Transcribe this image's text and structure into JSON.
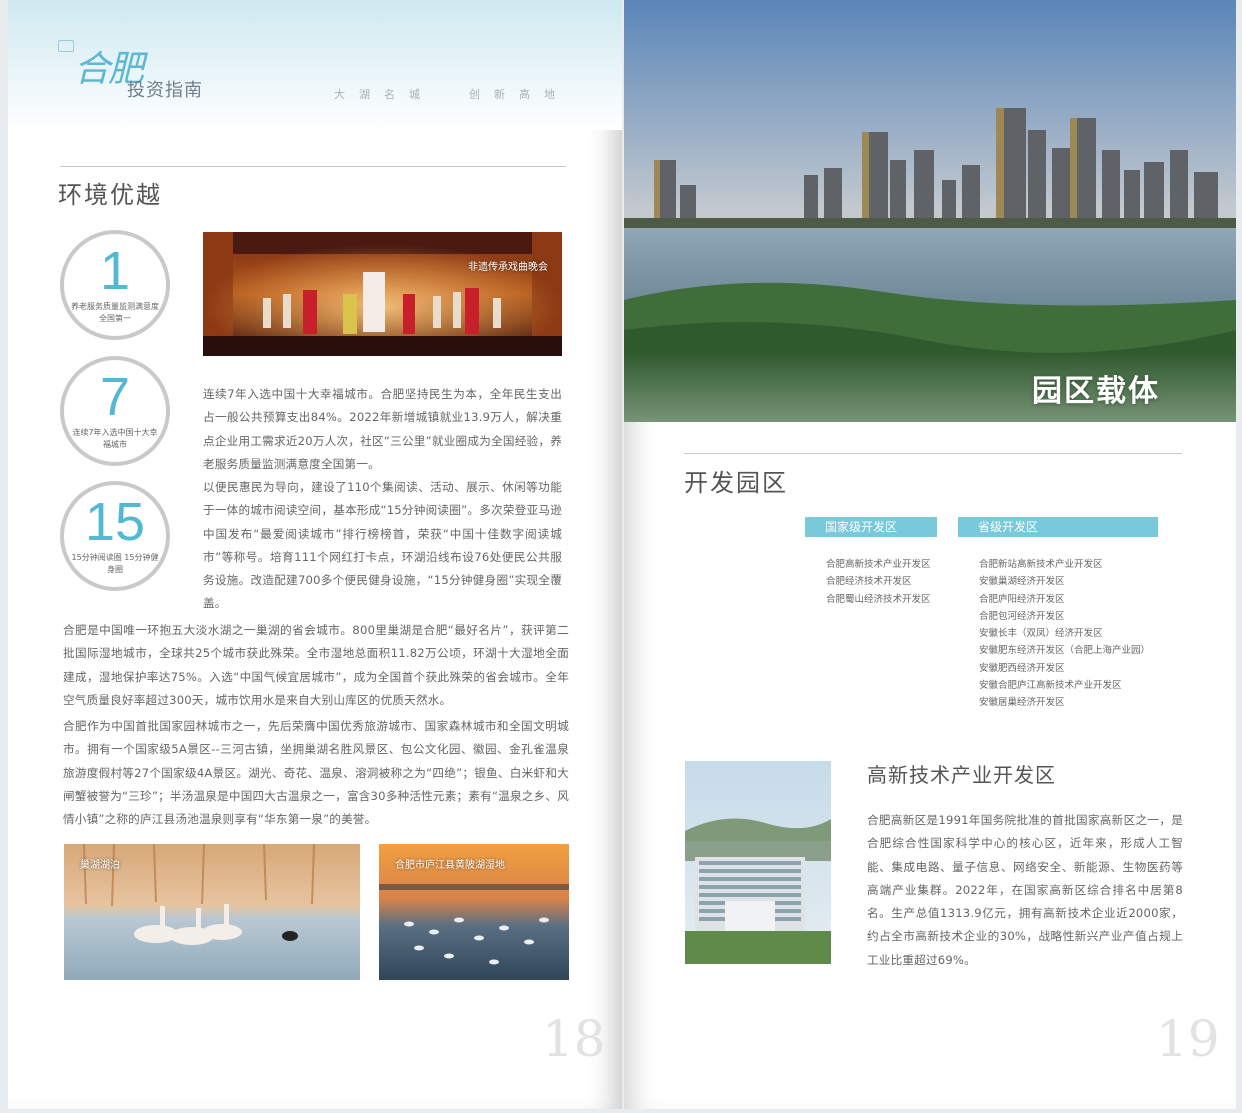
{
  "left_page": {
    "header": {
      "logo_script": "合肥",
      "logo_text": "投资指南",
      "slogan_1": "大湖名城",
      "slogan_2": "创新高地"
    },
    "section_title": "环境优越",
    "stats": [
      {
        "number": "1",
        "caption": "养老服务质量监测满意度全国第一"
      },
      {
        "number": "7",
        "caption": "连续7年入选中国十大幸福城市"
      },
      {
        "number": "15",
        "caption": "15分钟阅读圈 15分钟健身圈"
      }
    ],
    "opera_caption": "非遗传承戏曲晚会",
    "para_1": "连续7年入选中国十大幸福城市。合肥坚持民生为本，全年民生支出占一般公共预算支出84%。2022年新增城镇就业13.9万人，解决重点企业用工需求近20万人次，社区“三公里”就业圈成为全国经验，养老服务质量监测满意度全国第一。",
    "para_2": "以便民惠民为导向，建设了110个集阅读、活动、展示、休闲等功能于一体的城市阅读空间，基本形成“15分钟阅读圈”。多次荣登亚马逊中国发布“最爱阅读城市”排行榜榜首，荣获“中国十佳数字阅读城市”等称号。培育111个网红打卡点，环湖沿线布设76处便民公共服务设施。改造配建700多个便民健身设施，“15分钟健身圈”实现全覆盖。",
    "para_3": "合肥是中国唯一环抱五大淡水湖之一巢湖的省会城市。800里巢湖是合肥“最好名片”，获评第二批国际湿地城市，全球共25个城市获此殊荣。全市湿地总面积11.82万公顷，环湖十大湿地全面建成，湿地保护率达75%。入选“中国气候宜居城市”，成为全国首个获此殊荣的省会城市。全年空气质量良好率超过300天，城市饮用水是来自大别山库区的优质天然水。",
    "para_4": "合肥作为中国首批国家园林城市之一，先后荣膺中国优秀旅游城市、国家森林城市和全国文明城市。拥有一个国家级5A景区--三河古镇，坐拥巢湖名胜风景区、包公文化园、徽园、金孔雀温泉旅游度假村等27个国家级4A景区。湖光、奇花、温泉、溶洞被称之为“四绝”；银鱼、白米虾和大闸蟹被誉为“三珍”；半汤温泉是中国四大古温泉之一，富含30多种活性元素；素有“温泉之乡、风情小镇”之称的庐江县汤池温泉则享有“华东第一泉”的美誉。",
    "photo_1_caption": "巢湖湖泊",
    "photo_2_caption": "合肥市庐江县黄陂湖湿地",
    "page_number": "18"
  },
  "right_page": {
    "banner_title": "园区载体",
    "section_title": "开发园区",
    "national_tag": "国家级开发区",
    "provincial_tag": "省级开发区",
    "national_list": [
      "合肥高新技术产业开发区",
      "合肥经济技术开发区",
      "合肥蜀山经济技术开发区"
    ],
    "provincial_list": [
      "合肥新站高新技术产业开发区",
      "安徽巢湖经济开发区",
      "合肥庐阳经济开发区",
      "合肥包河经济开发区",
      "安徽长丰（双凤）经济开发区",
      "安徽肥东经济开发区（合肥上海产业园）",
      "安徽肥西经济开发区",
      "安徽合肥庐江高新技术产业开发区",
      "安徽居巢经济开发区"
    ],
    "hightech_title": "高新技术产业开发区",
    "hightech_para": "合肥高新区是1991年国务院批准的首批国家高新区之一，是合肥综合性国家科学中心的核心区，近年来，形成人工智能、集成电路、量子信息、网络安全、新能源、生物医药等高端产业集群。2022年，在国家高新区综合排名中居第8名。生产总值1313.9亿元，拥有高新技术企业近2000家，约占全市高新技术企业的30%，战略性新兴产业产值占规上工业比重超过69%。",
    "page_number": "19"
  }
}
